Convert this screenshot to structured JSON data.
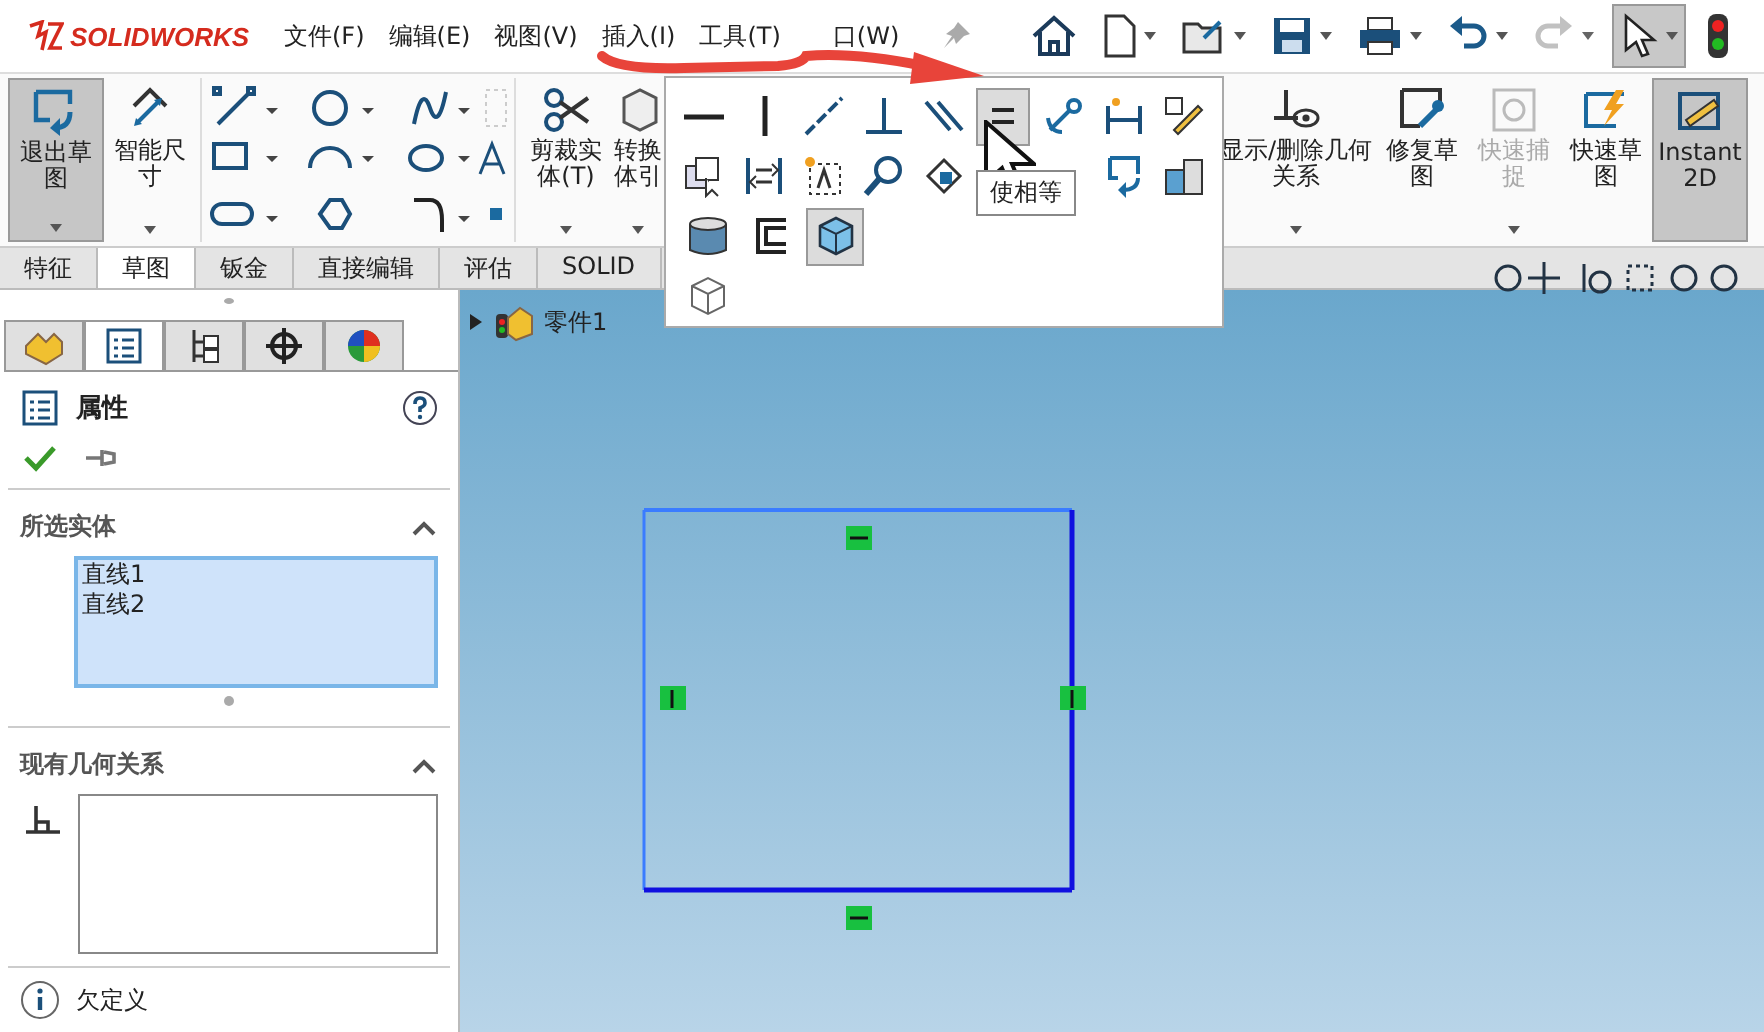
{
  "app": {
    "logo": "SOLIDWORKS",
    "menus": [
      {
        "label": "文件(F)"
      },
      {
        "label": "编辑(E)"
      },
      {
        "label": "视图(V)"
      },
      {
        "label": "插入(I)"
      },
      {
        "label": "工具(T)"
      },
      {
        "label": "口(W)"
      }
    ]
  },
  "quick_access": [
    {
      "kind": "home",
      "disabled": false,
      "selected": false
    },
    {
      "kind": "new",
      "disabled": false,
      "selected": false
    },
    {
      "kind": "open",
      "disabled": false,
      "selected": false
    },
    {
      "kind": "save",
      "disabled": false,
      "selected": false
    },
    {
      "kind": "print",
      "disabled": false,
      "selected": false
    },
    {
      "kind": "undo",
      "disabled": false,
      "selected": false
    },
    {
      "kind": "redo",
      "disabled": true,
      "selected": false
    },
    {
      "kind": "select",
      "disabled": false,
      "selected": true
    },
    {
      "kind": "rebuild",
      "disabled": false,
      "selected": false
    }
  ],
  "ribbon_left": [
    {
      "kind": "exit",
      "label": "退出草图",
      "selected": true,
      "disabled": false
    },
    {
      "kind": "dimension",
      "label": "智能尺寸",
      "selected": false,
      "disabled": false
    }
  ],
  "ribbon_mid": [
    {
      "kind": "trim",
      "label": "剪裁实体(T)",
      "selected": false,
      "disabled": false
    },
    {
      "kind": "convert",
      "label": "转换体引",
      "selected": false,
      "disabled": false
    }
  ],
  "ribbon_right": [
    {
      "kind": "relations",
      "label": "显示/删除几何关系",
      "selected": false,
      "disabled": false
    },
    {
      "kind": "repair",
      "label": "修复草图",
      "selected": false,
      "disabled": false
    },
    {
      "kind": "snap",
      "label": "快速捕捉",
      "selected": false,
      "disabled": true
    },
    {
      "kind": "rapid",
      "label": "快速草图",
      "selected": false,
      "disabled": false
    },
    {
      "kind": "instant",
      "label": "Instant2D",
      "selected": true,
      "disabled": false
    }
  ],
  "tabs": [
    {
      "label": "特征",
      "selected": false
    },
    {
      "label": "草图",
      "selected": true
    },
    {
      "label": "钣金",
      "selected": false
    },
    {
      "label": "直接编辑",
      "selected": false
    },
    {
      "label": "评估",
      "selected": false
    },
    {
      "label": "SOLID",
      "selected": false
    }
  ],
  "relations_popup": {
    "rows": [
      [
        {
          "kind": "horizontal",
          "highlighted": false
        },
        {
          "kind": "vertical",
          "highlighted": false
        },
        {
          "kind": "collinear",
          "highlighted": false
        },
        {
          "kind": "perpendicular",
          "highlighted": false
        },
        {
          "kind": "parallel",
          "highlighted": false
        },
        {
          "kind": "equal",
          "highlighted": true
        },
        {
          "kind": "fix",
          "highlighted": false
        },
        {
          "kind": "dim",
          "highlighted": false
        },
        {
          "kind": "edit",
          "highlighted": false
        }
      ],
      [
        {
          "kind": "copy",
          "highlighted": false
        },
        {
          "kind": "swap",
          "highlighted": false
        },
        {
          "kind": "text",
          "highlighted": false
        },
        {
          "kind": "find",
          "highlighted": false
        },
        {
          "kind": "nodes",
          "highlighted": false
        },
        {
          "kind": "blank",
          "highlighted": false
        },
        {
          "kind": "blank",
          "highlighted": false
        },
        {
          "kind": "loop",
          "highlighted": false
        },
        {
          "kind": "block",
          "highlighted": false
        }
      ],
      [
        {
          "kind": "cylinder",
          "highlighted": false
        },
        {
          "kind": "offset",
          "highlighted": false
        },
        {
          "kind": "cube",
          "highlighted": true
        }
      ],
      [
        {
          "kind": "wirecube",
          "highlighted": false
        }
      ]
    ],
    "tooltip": "使相等"
  },
  "property_manager": {
    "panel_tabs": [
      {
        "kind": "feature",
        "selected": false
      },
      {
        "kind": "property",
        "selected": true
      },
      {
        "kind": "config",
        "selected": false
      },
      {
        "kind": "dimxpert",
        "selected": false
      },
      {
        "kind": "display",
        "selected": false
      }
    ],
    "title": "属性",
    "sections": [
      {
        "title": "所选实体",
        "items": [
          "直线1",
          "直线2"
        ],
        "highlighted": true
      },
      {
        "title": "现有几何关系",
        "highlighted": false
      }
    ],
    "status": "欠定义"
  },
  "tree": {
    "part": "零件1"
  },
  "sketch": {
    "relations": [
      {
        "kind": "horizontal"
      },
      {
        "kind": "horizontal"
      },
      {
        "kind": "vertical"
      },
      {
        "kind": "vertical"
      }
    ]
  }
}
